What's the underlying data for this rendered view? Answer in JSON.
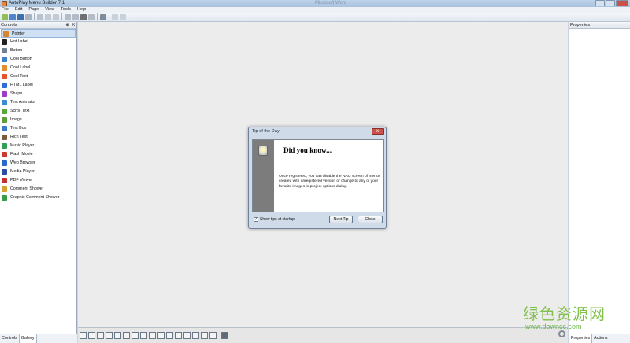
{
  "window": {
    "title": "AutoPlay Menu Builder 7.1",
    "title_ghost": "Microsoft Word"
  },
  "menu": [
    "File",
    "Edit",
    "Page",
    "View",
    "Tools",
    "Help"
  ],
  "toolbar_icons": [
    "new-icon",
    "open-icon",
    "save-icon",
    "options-icon",
    "play-icon",
    "undo-icon",
    "redo-icon",
    "cut-icon",
    "copy-icon",
    "delete-icon",
    "paste-icon",
    "preview-icon",
    "zoom-in-icon",
    "zoom-out-icon"
  ],
  "controls_panel": {
    "title": "Controls",
    "pin": "⊕",
    "close": "X",
    "items": [
      {
        "label": "Pointer",
        "icon": "pointer-icon",
        "color": "#d7852d",
        "selected": true
      },
      {
        "label": "Hot Label",
        "icon": "text-a-icon",
        "color": "#222222"
      },
      {
        "label": "Button",
        "icon": "button-icon",
        "color": "#6f7f95"
      },
      {
        "label": "Cool Button",
        "icon": "cool-button-icon",
        "color": "#3e7fc5"
      },
      {
        "label": "Cool Label",
        "icon": "cool-label-icon",
        "color": "#e58d2d"
      },
      {
        "label": "Cool Text",
        "icon": "cool-text-icon",
        "color": "#e5542d"
      },
      {
        "label": "HTML Label",
        "icon": "globe-icon",
        "color": "#2d6fd6"
      },
      {
        "label": "Shape",
        "icon": "shape-icon",
        "color": "#9c3cc8"
      },
      {
        "label": "Text Animator",
        "icon": "text-animator-icon",
        "color": "#3b8cd2"
      },
      {
        "label": "Scroll Text",
        "icon": "scroll-text-icon",
        "color": "#57a83b"
      },
      {
        "label": "Image",
        "icon": "image-icon",
        "color": "#5f9c3a"
      },
      {
        "label": "Text Box",
        "icon": "text-box-icon",
        "color": "#3b7cc6"
      },
      {
        "label": "Rich Text",
        "icon": "rich-text-icon",
        "color": "#7c5a3a"
      },
      {
        "label": "Music Player",
        "icon": "music-note-icon",
        "color": "#2f9f52"
      },
      {
        "label": "Flash Movie",
        "icon": "flash-icon",
        "color": "#cc3a2f"
      },
      {
        "label": "Web Browser",
        "icon": "web-browser-icon",
        "color": "#2a68c9"
      },
      {
        "label": "Media Player",
        "icon": "media-player-icon",
        "color": "#2a4fa0"
      },
      {
        "label": "PDF Viewer",
        "icon": "pdf-icon",
        "color": "#c42f2f"
      },
      {
        "label": "Comment Shower",
        "icon": "comment-icon",
        "color": "#d6a12d"
      },
      {
        "label": "Graphic Comment Shower",
        "icon": "graphic-comment-icon",
        "color": "#3a9b46"
      }
    ],
    "tabs": [
      "Controls",
      "Gallery"
    ]
  },
  "properties_panel": {
    "title": "Properties",
    "tabs": [
      "Properties",
      "Actions"
    ]
  },
  "dialog": {
    "title": "Tip of the Day",
    "close_glyph": "x",
    "headline": "Did you know...",
    "text": "Once registered, you can disable the NAG screen of menus created with unregistered version or change to any of your favorite images in project options dialog.",
    "checkbox_label": "Show tips at startup",
    "checkbox_checked": "✓",
    "next_button": "Next Tip",
    "close_button": "Close"
  },
  "watermark": {
    "cn": "绿色资源网",
    "url": "www.downcc.com"
  }
}
